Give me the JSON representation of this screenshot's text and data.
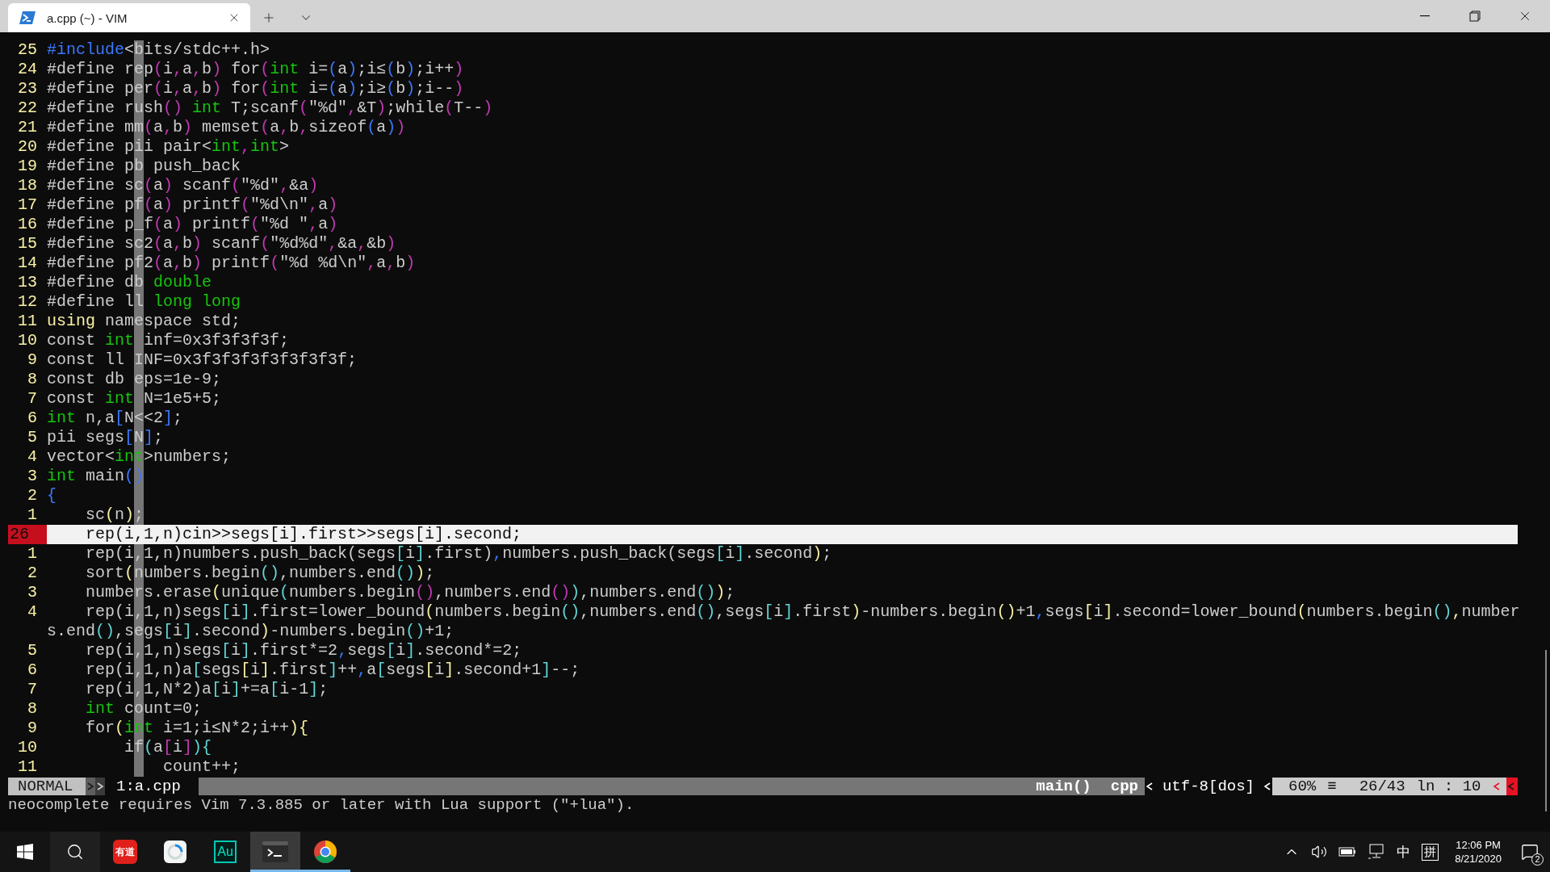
{
  "tab": {
    "title": "a.cpp (~) - VIM",
    "selected": true
  },
  "editor": {
    "lines": [
      {
        "kind": "line",
        "number": "25",
        "current": false,
        "tokens": [
          {
            "kind": "pre",
            "text": "#include"
          },
          {
            "kind": "plain",
            "text": "<bits/stdc++.h>"
          }
        ]
      },
      {
        "kind": "line",
        "number": "24",
        "current": false,
        "tokens": [
          {
            "kind": "plain",
            "text": "#define rep"
          },
          {
            "kind": "macro",
            "text": "("
          },
          {
            "kind": "plain",
            "text": "i"
          },
          {
            "kind": "macro",
            "text": ","
          },
          {
            "kind": "plain",
            "text": "a"
          },
          {
            "kind": "macro",
            "text": ","
          },
          {
            "kind": "plain",
            "text": "b"
          },
          {
            "kind": "macro",
            "text": ")"
          },
          {
            "kind": "plain",
            "text": " for"
          },
          {
            "kind": "macro",
            "text": "("
          },
          {
            "kind": "type",
            "text": "int"
          },
          {
            "kind": "plain",
            "text": " i="
          },
          {
            "kind": "group",
            "text": "("
          },
          {
            "kind": "plain",
            "text": "a"
          },
          {
            "kind": "group",
            "text": ")"
          },
          {
            "kind": "plain",
            "text": ";i≤"
          },
          {
            "kind": "group",
            "text": "("
          },
          {
            "kind": "plain",
            "text": "b"
          },
          {
            "kind": "group",
            "text": ")"
          },
          {
            "kind": "plain",
            "text": ";i++"
          },
          {
            "kind": "macro",
            "text": ")"
          }
        ]
      },
      {
        "kind": "line",
        "number": "23",
        "current": false,
        "tokens": [
          {
            "kind": "plain",
            "text": "#define per"
          },
          {
            "kind": "macro",
            "text": "("
          },
          {
            "kind": "plain",
            "text": "i"
          },
          {
            "kind": "macro",
            "text": ","
          },
          {
            "kind": "plain",
            "text": "a"
          },
          {
            "kind": "macro",
            "text": ","
          },
          {
            "kind": "plain",
            "text": "b"
          },
          {
            "kind": "macro",
            "text": ")"
          },
          {
            "kind": "plain",
            "text": " for"
          },
          {
            "kind": "macro",
            "text": "("
          },
          {
            "kind": "type",
            "text": "int"
          },
          {
            "kind": "plain",
            "text": " i="
          },
          {
            "kind": "group",
            "text": "("
          },
          {
            "kind": "plain",
            "text": "a"
          },
          {
            "kind": "group",
            "text": ")"
          },
          {
            "kind": "plain",
            "text": ";i≥"
          },
          {
            "kind": "group",
            "text": "("
          },
          {
            "kind": "plain",
            "text": "b"
          },
          {
            "kind": "group",
            "text": ")"
          },
          {
            "kind": "plain",
            "text": ";i--"
          },
          {
            "kind": "macro",
            "text": ")"
          }
        ]
      },
      {
        "kind": "line",
        "number": "22",
        "current": false,
        "tokens": [
          {
            "kind": "plain",
            "text": "#define rush"
          },
          {
            "kind": "macro",
            "text": "()"
          },
          {
            "kind": "type",
            "text": " int"
          },
          {
            "kind": "plain",
            "text": " T;scanf"
          },
          {
            "kind": "macro",
            "text": "("
          },
          {
            "kind": "plain",
            "text": "\"%d\""
          },
          {
            "kind": "macro",
            "text": ","
          },
          {
            "kind": "plain",
            "text": "&T"
          },
          {
            "kind": "macro",
            "text": ")"
          },
          {
            "kind": "plain",
            "text": ";while"
          },
          {
            "kind": "macro",
            "text": "("
          },
          {
            "kind": "plain",
            "text": "T--"
          },
          {
            "kind": "macro",
            "text": ")"
          }
        ]
      },
      {
        "kind": "line",
        "number": "21",
        "current": false,
        "tokens": [
          {
            "kind": "plain",
            "text": "#define mm"
          },
          {
            "kind": "macro",
            "text": "("
          },
          {
            "kind": "plain",
            "text": "a"
          },
          {
            "kind": "macro",
            "text": ","
          },
          {
            "kind": "plain",
            "text": "b"
          },
          {
            "kind": "macro",
            "text": ")"
          },
          {
            "kind": "plain",
            "text": " memset"
          },
          {
            "kind": "macro",
            "text": "("
          },
          {
            "kind": "plain",
            "text": "a"
          },
          {
            "kind": "macro",
            "text": ","
          },
          {
            "kind": "plain",
            "text": "b"
          },
          {
            "kind": "macro",
            "text": ","
          },
          {
            "kind": "plain",
            "text": "sizeof"
          },
          {
            "kind": "group",
            "text": "("
          },
          {
            "kind": "plain",
            "text": "a"
          },
          {
            "kind": "group",
            "text": ")"
          },
          {
            "kind": "macro",
            "text": ")"
          }
        ]
      },
      {
        "kind": "line",
        "number": "20",
        "current": false,
        "tokens": [
          {
            "kind": "plain",
            "text": "#define pii pair<"
          },
          {
            "kind": "type",
            "text": "int"
          },
          {
            "kind": "macro",
            "text": ","
          },
          {
            "kind": "type",
            "text": "int"
          },
          {
            "kind": "plain",
            "text": ">"
          }
        ]
      },
      {
        "kind": "line",
        "number": "19",
        "current": false,
        "tokens": [
          {
            "kind": "plain",
            "text": "#define pb push_back"
          }
        ]
      },
      {
        "kind": "line",
        "number": "18",
        "current": false,
        "tokens": [
          {
            "kind": "plain",
            "text": "#define sc"
          },
          {
            "kind": "macro",
            "text": "("
          },
          {
            "kind": "plain",
            "text": "a"
          },
          {
            "kind": "macro",
            "text": ")"
          },
          {
            "kind": "plain",
            "text": " scanf"
          },
          {
            "kind": "macro",
            "text": "("
          },
          {
            "kind": "plain",
            "text": "\"%d\""
          },
          {
            "kind": "macro",
            "text": ","
          },
          {
            "kind": "plain",
            "text": "&a"
          },
          {
            "kind": "macro",
            "text": ")"
          }
        ]
      },
      {
        "kind": "line",
        "number": "17",
        "current": false,
        "tokens": [
          {
            "kind": "plain",
            "text": "#define pf"
          },
          {
            "kind": "macro",
            "text": "("
          },
          {
            "kind": "plain",
            "text": "a"
          },
          {
            "kind": "macro",
            "text": ")"
          },
          {
            "kind": "plain",
            "text": " printf"
          },
          {
            "kind": "macro",
            "text": "("
          },
          {
            "kind": "plain",
            "text": "\"%d\\n\""
          },
          {
            "kind": "macro",
            "text": ","
          },
          {
            "kind": "plain",
            "text": "a"
          },
          {
            "kind": "macro",
            "text": ")"
          }
        ]
      },
      {
        "kind": "line",
        "number": "16",
        "current": false,
        "tokens": [
          {
            "kind": "plain",
            "text": "#define p_f"
          },
          {
            "kind": "macro",
            "text": "("
          },
          {
            "kind": "plain",
            "text": "a"
          },
          {
            "kind": "macro",
            "text": ")"
          },
          {
            "kind": "plain",
            "text": " printf"
          },
          {
            "kind": "macro",
            "text": "("
          },
          {
            "kind": "plain",
            "text": "\"%d \""
          },
          {
            "kind": "macro",
            "text": ","
          },
          {
            "kind": "plain",
            "text": "a"
          },
          {
            "kind": "macro",
            "text": ")"
          }
        ]
      },
      {
        "kind": "line",
        "number": "15",
        "current": false,
        "tokens": [
          {
            "kind": "plain",
            "text": "#define sc2"
          },
          {
            "kind": "macro",
            "text": "("
          },
          {
            "kind": "plain",
            "text": "a"
          },
          {
            "kind": "macro",
            "text": ","
          },
          {
            "kind": "plain",
            "text": "b"
          },
          {
            "kind": "macro",
            "text": ")"
          },
          {
            "kind": "plain",
            "text": " scanf"
          },
          {
            "kind": "macro",
            "text": "("
          },
          {
            "kind": "plain",
            "text": "\"%d%d\""
          },
          {
            "kind": "macro",
            "text": ","
          },
          {
            "kind": "plain",
            "text": "&a"
          },
          {
            "kind": "macro",
            "text": ","
          },
          {
            "kind": "plain",
            "text": "&b"
          },
          {
            "kind": "macro",
            "text": ")"
          }
        ]
      },
      {
        "kind": "line",
        "number": "14",
        "current": false,
        "tokens": [
          {
            "kind": "plain",
            "text": "#define pf2"
          },
          {
            "kind": "macro",
            "text": "("
          },
          {
            "kind": "plain",
            "text": "a"
          },
          {
            "kind": "macro",
            "text": ","
          },
          {
            "kind": "plain",
            "text": "b"
          },
          {
            "kind": "macro",
            "text": ")"
          },
          {
            "kind": "plain",
            "text": " printf"
          },
          {
            "kind": "macro",
            "text": "("
          },
          {
            "kind": "plain",
            "text": "\"%d %d\\n\""
          },
          {
            "kind": "macro",
            "text": ","
          },
          {
            "kind": "plain",
            "text": "a"
          },
          {
            "kind": "macro",
            "text": ","
          },
          {
            "kind": "plain",
            "text": "b"
          },
          {
            "kind": "macro",
            "text": ")"
          }
        ]
      },
      {
        "kind": "line",
        "number": "13",
        "current": false,
        "tokens": [
          {
            "kind": "plain",
            "text": "#define db"
          },
          {
            "kind": "type",
            "text": " double"
          }
        ]
      },
      {
        "kind": "line",
        "number": "12",
        "current": false,
        "tokens": [
          {
            "kind": "plain",
            "text": "#define ll"
          },
          {
            "kind": "type",
            "text": " long long"
          }
        ]
      },
      {
        "kind": "line",
        "number": "11",
        "current": false,
        "tokens": [
          {
            "kind": "stmt",
            "text": "using"
          },
          {
            "kind": "plain",
            "text": " namespace std;"
          }
        ]
      },
      {
        "kind": "line",
        "number": "10",
        "current": false,
        "tokens": [
          {
            "kind": "plain",
            "text": "const"
          },
          {
            "kind": "type",
            "text": " int"
          },
          {
            "kind": "plain",
            "text": " inf=0x3f3f3f3f;"
          }
        ]
      },
      {
        "kind": "line",
        "number": "9",
        "current": false,
        "tokens": [
          {
            "kind": "plain",
            "text": "const ll INF=0x3f3f3f3f3f3f3f3f;"
          }
        ]
      },
      {
        "kind": "line",
        "number": "8",
        "current": false,
        "tokens": [
          {
            "kind": "plain",
            "text": "const db eps=1e-9;"
          }
        ]
      },
      {
        "kind": "line",
        "number": "7",
        "current": false,
        "tokens": [
          {
            "kind": "plain",
            "text": "const"
          },
          {
            "kind": "type",
            "text": " int"
          },
          {
            "kind": "plain",
            "text": " N=1e5+5;"
          }
        ]
      },
      {
        "kind": "line",
        "number": "6",
        "current": false,
        "tokens": [
          {
            "kind": "type",
            "text": "int"
          },
          {
            "kind": "plain",
            "text": " n,a"
          },
          {
            "kind": "group",
            "text": "["
          },
          {
            "kind": "plain",
            "text": "N<<2"
          },
          {
            "kind": "group",
            "text": "]"
          },
          {
            "kind": "plain",
            "text": ";"
          }
        ]
      },
      {
        "kind": "line",
        "number": "5",
        "current": false,
        "tokens": [
          {
            "kind": "plain",
            "text": "pii segs"
          },
          {
            "kind": "group",
            "text": "["
          },
          {
            "kind": "plain",
            "text": "N"
          },
          {
            "kind": "group",
            "text": "]"
          },
          {
            "kind": "plain",
            "text": ";"
          }
        ]
      },
      {
        "kind": "line",
        "number": "4",
        "current": false,
        "tokens": [
          {
            "kind": "plain",
            "text": "vector<"
          },
          {
            "kind": "type",
            "text": "int"
          },
          {
            "kind": "plain",
            "text": ">numbers;"
          }
        ]
      },
      {
        "kind": "line",
        "number": "3",
        "current": false,
        "tokens": [
          {
            "kind": "type",
            "text": "int"
          },
          {
            "kind": "plain",
            "text": " main"
          },
          {
            "kind": "group",
            "text": "()"
          }
        ]
      },
      {
        "kind": "line",
        "number": "2",
        "current": false,
        "tokens": [
          {
            "kind": "group",
            "text": "{"
          }
        ]
      },
      {
        "kind": "line",
        "number": "1",
        "current": false,
        "tokens": [
          {
            "kind": "plain",
            "text": "    sc"
          },
          {
            "kind": "call",
            "text": "("
          },
          {
            "kind": "plain",
            "text": "n"
          },
          {
            "kind": "call",
            "text": ")"
          },
          {
            "kind": "plain",
            "text": ";"
          }
        ]
      },
      {
        "kind": "line",
        "number": "26",
        "current": true,
        "tokens": [
          {
            "kind": "plain",
            "text": "    rep(i,1,n)cin>>segs[i].first>>segs[i].second;"
          }
        ]
      },
      {
        "kind": "line",
        "number": "1",
        "current": false,
        "tokens": [
          {
            "kind": "plain",
            "text": "    rep(i,1,n)numbers.push_back(segs"
          },
          {
            "kind": "index",
            "text": "["
          },
          {
            "kind": "plain",
            "text": "i"
          },
          {
            "kind": "index",
            "text": "]"
          },
          {
            "kind": "plain",
            "text": ".first)"
          },
          {
            "kind": "group",
            "text": ","
          },
          {
            "kind": "plain",
            "text": "numbers.push_back(segs"
          },
          {
            "kind": "index",
            "text": "["
          },
          {
            "kind": "plain",
            "text": "i"
          },
          {
            "kind": "index",
            "text": "]"
          },
          {
            "kind": "plain",
            "text": ".second"
          },
          {
            "kind": "call",
            "text": ")"
          },
          {
            "kind": "plain",
            "text": ";"
          }
        ]
      },
      {
        "kind": "line",
        "number": "2",
        "current": false,
        "tokens": [
          {
            "kind": "plain",
            "text": "    sort"
          },
          {
            "kind": "call",
            "text": "("
          },
          {
            "kind": "plain",
            "text": "numbers.begin"
          },
          {
            "kind": "index",
            "text": "()"
          },
          {
            "kind": "plain",
            "text": ",numbers.end"
          },
          {
            "kind": "index",
            "text": "()"
          },
          {
            "kind": "call",
            "text": ")"
          },
          {
            "kind": "plain",
            "text": ";"
          }
        ]
      },
      {
        "kind": "line",
        "number": "3",
        "current": false,
        "tokens": [
          {
            "kind": "plain",
            "text": "    numbers.erase"
          },
          {
            "kind": "call",
            "text": "("
          },
          {
            "kind": "plain",
            "text": "unique"
          },
          {
            "kind": "index",
            "text": "("
          },
          {
            "kind": "plain",
            "text": "numbers.begin"
          },
          {
            "kind": "macro",
            "text": "()"
          },
          {
            "kind": "plain",
            "text": ",numbers.end"
          },
          {
            "kind": "macro",
            "text": "()"
          },
          {
            "kind": "index",
            "text": ")"
          },
          {
            "kind": "plain",
            "text": ",numbers.end"
          },
          {
            "kind": "index",
            "text": "()"
          },
          {
            "kind": "call",
            "text": ")"
          },
          {
            "kind": "plain",
            "text": ";"
          }
        ]
      },
      {
        "kind": "line",
        "number": "4",
        "current": false,
        "tokens": [
          {
            "kind": "plain",
            "text": "    rep(i,1,n)segs"
          },
          {
            "kind": "index",
            "text": "["
          },
          {
            "kind": "plain",
            "text": "i"
          },
          {
            "kind": "index",
            "text": "]"
          },
          {
            "kind": "plain",
            "text": ".first=lower_bound"
          },
          {
            "kind": "call",
            "text": "("
          },
          {
            "kind": "plain",
            "text": "numbers.begin"
          },
          {
            "kind": "index",
            "text": "()"
          },
          {
            "kind": "plain",
            "text": ",numbers.end"
          },
          {
            "kind": "index",
            "text": "()"
          },
          {
            "kind": "plain",
            "text": ",segs"
          },
          {
            "kind": "index",
            "text": "["
          },
          {
            "kind": "plain",
            "text": "i"
          },
          {
            "kind": "index",
            "text": "]"
          },
          {
            "kind": "plain",
            "text": ".first"
          },
          {
            "kind": "call",
            "text": ")"
          },
          {
            "kind": "plain",
            "text": "-numbers.begin"
          },
          {
            "kind": "call",
            "text": "()"
          },
          {
            "kind": "plain",
            "text": "+1"
          },
          {
            "kind": "group",
            "text": ","
          },
          {
            "kind": "plain",
            "text": "segs"
          },
          {
            "kind": "call",
            "text": "["
          },
          {
            "kind": "plain",
            "text": "i"
          },
          {
            "kind": "call",
            "text": "]"
          },
          {
            "kind": "plain",
            "text": ".second=lower_bound"
          },
          {
            "kind": "call",
            "text": "("
          },
          {
            "kind": "plain",
            "text": "numbers.begin"
          },
          {
            "kind": "index",
            "text": "()"
          },
          {
            "kind": "call",
            "text": ","
          },
          {
            "kind": "plain",
            "text": "number"
          }
        ]
      },
      {
        "kind": "wrap",
        "tokens": [
          {
            "kind": "plain",
            "text": "s.end"
          },
          {
            "kind": "index",
            "text": "()"
          },
          {
            "kind": "plain",
            "text": ",segs"
          },
          {
            "kind": "index",
            "text": "["
          },
          {
            "kind": "plain",
            "text": "i"
          },
          {
            "kind": "index",
            "text": "]"
          },
          {
            "kind": "plain",
            "text": ".second"
          },
          {
            "kind": "call",
            "text": ")"
          },
          {
            "kind": "plain",
            "text": "-numbers.begin"
          },
          {
            "kind": "index",
            "text": "()"
          },
          {
            "kind": "plain",
            "text": "+1;"
          }
        ]
      },
      {
        "kind": "line",
        "number": "5",
        "current": false,
        "tokens": [
          {
            "kind": "plain",
            "text": "    rep(i,1,n)segs"
          },
          {
            "kind": "index",
            "text": "["
          },
          {
            "kind": "plain",
            "text": "i"
          },
          {
            "kind": "index",
            "text": "]"
          },
          {
            "kind": "plain",
            "text": ".first*=2"
          },
          {
            "kind": "group",
            "text": ","
          },
          {
            "kind": "plain",
            "text": "segs"
          },
          {
            "kind": "index",
            "text": "["
          },
          {
            "kind": "plain",
            "text": "i"
          },
          {
            "kind": "index",
            "text": "]"
          },
          {
            "kind": "plain",
            "text": ".second*=2;"
          }
        ]
      },
      {
        "kind": "line",
        "number": "6",
        "current": false,
        "tokens": [
          {
            "kind": "plain",
            "text": "    rep(i,1,n)a"
          },
          {
            "kind": "index",
            "text": "["
          },
          {
            "kind": "plain",
            "text": "segs"
          },
          {
            "kind": "call",
            "text": "["
          },
          {
            "kind": "plain",
            "text": "i"
          },
          {
            "kind": "call",
            "text": "]"
          },
          {
            "kind": "plain",
            "text": ".first"
          },
          {
            "kind": "index",
            "text": "]"
          },
          {
            "kind": "plain",
            "text": "++"
          },
          {
            "kind": "group",
            "text": ","
          },
          {
            "kind": "plain",
            "text": "a"
          },
          {
            "kind": "index",
            "text": "["
          },
          {
            "kind": "plain",
            "text": "segs"
          },
          {
            "kind": "call",
            "text": "["
          },
          {
            "kind": "plain",
            "text": "i"
          },
          {
            "kind": "call",
            "text": "]"
          },
          {
            "kind": "plain",
            "text": ".second+1"
          },
          {
            "kind": "index",
            "text": "]"
          },
          {
            "kind": "plain",
            "text": "--;"
          }
        ]
      },
      {
        "kind": "line",
        "number": "7",
        "current": false,
        "tokens": [
          {
            "kind": "plain",
            "text": "    rep(i,1,N*2)a"
          },
          {
            "kind": "index",
            "text": "["
          },
          {
            "kind": "plain",
            "text": "i"
          },
          {
            "kind": "index",
            "text": "]"
          },
          {
            "kind": "plain",
            "text": "+=a"
          },
          {
            "kind": "index",
            "text": "["
          },
          {
            "kind": "plain",
            "text": "i-1"
          },
          {
            "kind": "index",
            "text": "]"
          },
          {
            "kind": "plain",
            "text": ";"
          }
        ]
      },
      {
        "kind": "line",
        "number": "8",
        "current": false,
        "tokens": [
          {
            "kind": "type",
            "text": "    int"
          },
          {
            "kind": "plain",
            "text": " count=0;"
          }
        ]
      },
      {
        "kind": "line",
        "number": "9",
        "current": false,
        "tokens": [
          {
            "kind": "plain",
            "text": "    for"
          },
          {
            "kind": "call",
            "text": "("
          },
          {
            "kind": "type",
            "text": "int"
          },
          {
            "kind": "plain",
            "text": " i=1;i≤N*2;i++"
          },
          {
            "kind": "call",
            "text": "){"
          }
        ]
      },
      {
        "kind": "line",
        "number": "10",
        "current": false,
        "tokens": [
          {
            "kind": "plain",
            "text": "        if"
          },
          {
            "kind": "index",
            "text": "("
          },
          {
            "kind": "plain",
            "text": "a"
          },
          {
            "kind": "macro",
            "text": "["
          },
          {
            "kind": "plain",
            "text": "i"
          },
          {
            "kind": "macro",
            "text": "]"
          },
          {
            "kind": "index",
            "text": "){"
          }
        ]
      },
      {
        "kind": "line",
        "number": "11",
        "current": false,
        "tokens": [
          {
            "kind": "plain",
            "text": "            count++;"
          }
        ]
      }
    ]
  },
  "status_bar": {
    "mode": "NORMAL",
    "file": "1:a.cpp",
    "function": "main()",
    "filetype": "cpp",
    "encoding": "utf-8[dos]",
    "percent": "60%",
    "glyph": "≡",
    "position": "26/43",
    "cursor": "ln : 10"
  },
  "message": "neocomplete requires Vim 7.3.885 or later with Lua support (\"+lua\").",
  "taskbar": {
    "apps": [
      {
        "kind": "dictionary",
        "label": "有道",
        "selected": false,
        "running": false
      },
      {
        "kind": "browser-alt",
        "selected": false,
        "running": false
      },
      {
        "kind": "audition",
        "label": "Au",
        "selected": false,
        "running": false
      },
      {
        "kind": "terminal",
        "selected": true,
        "running": true
      },
      {
        "kind": "chrome",
        "selected": false,
        "running": true
      }
    ],
    "ime": "中",
    "ime_mode": "拼",
    "time": "12:06 PM",
    "date": "8/21/2020",
    "notifications": "2"
  }
}
